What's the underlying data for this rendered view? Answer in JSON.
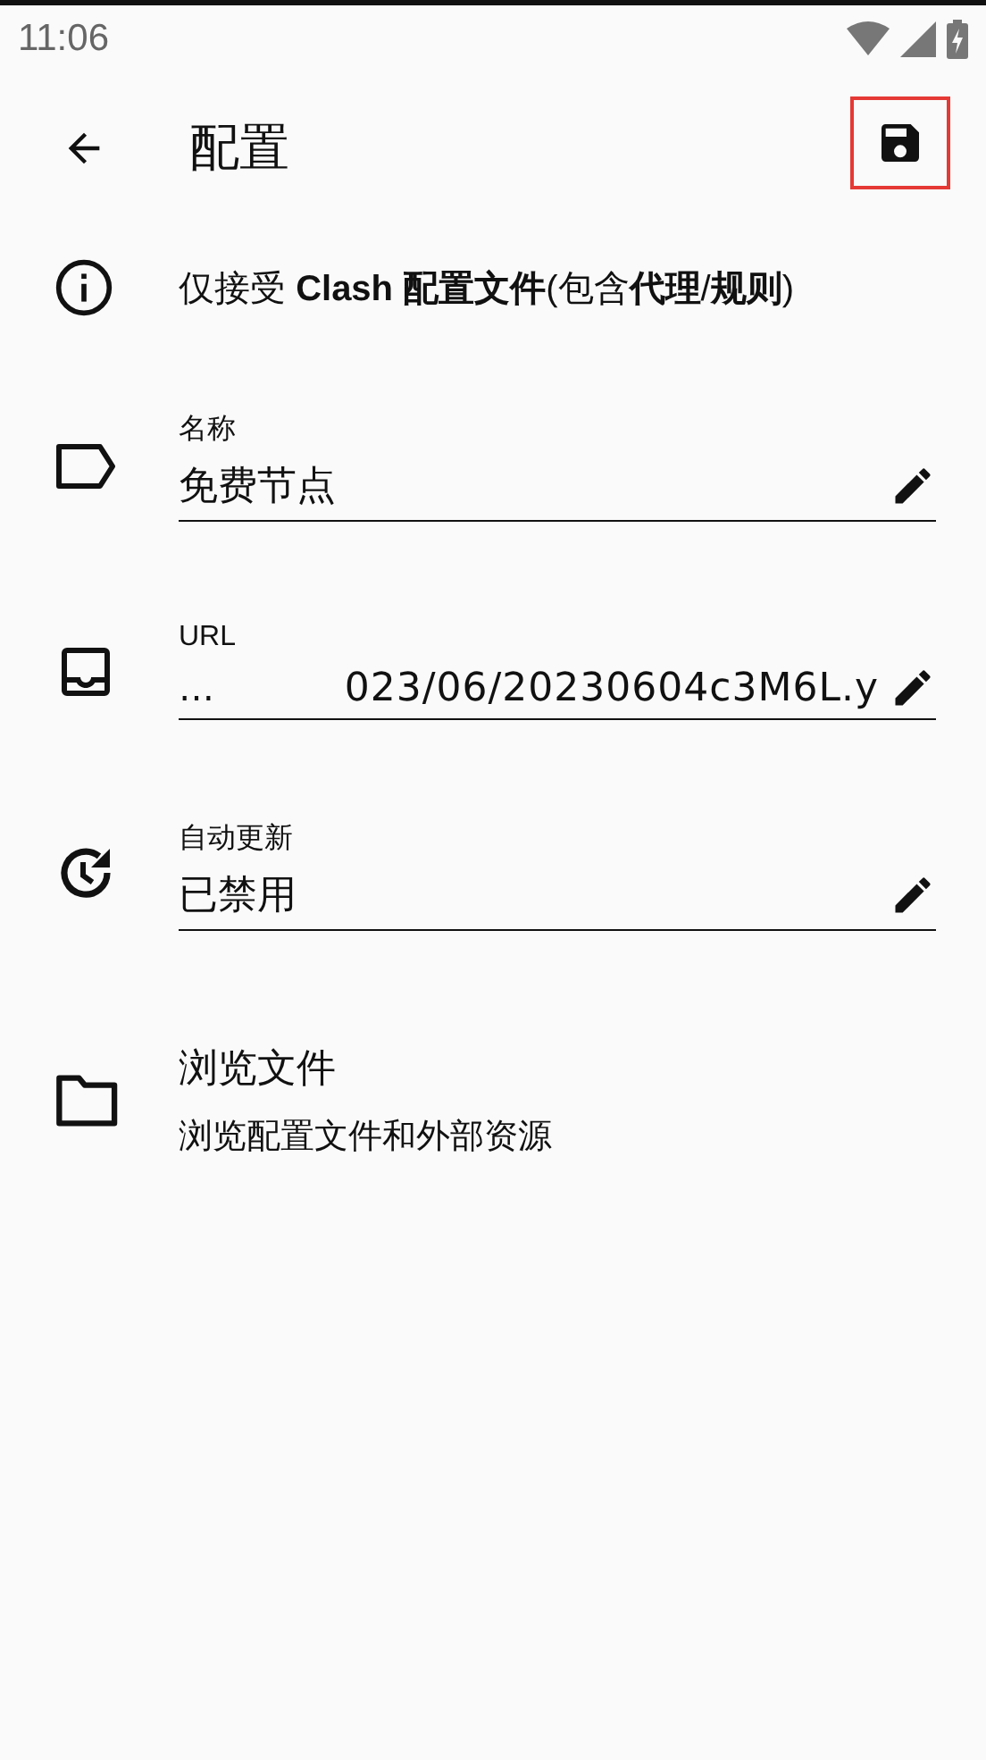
{
  "status_bar": {
    "time": "11:06"
  },
  "app_bar": {
    "title": "配置",
    "save_highlighted": true
  },
  "notice": {
    "text": "仅接受 **Clash 配置文件**(包含**代理**/**规则**)"
  },
  "fields": [
    {
      "kind": "name",
      "label": "名称",
      "value": "免费节点"
    },
    {
      "kind": "url",
      "label": "URL",
      "prefix": "…",
      "value": "023/06/20230604c3M6L.y"
    },
    {
      "kind": "update",
      "label": "自动更新",
      "value": "已禁用"
    }
  ],
  "browse": {
    "title": "浏览文件",
    "subtitle": "浏览配置文件和外部资源"
  }
}
